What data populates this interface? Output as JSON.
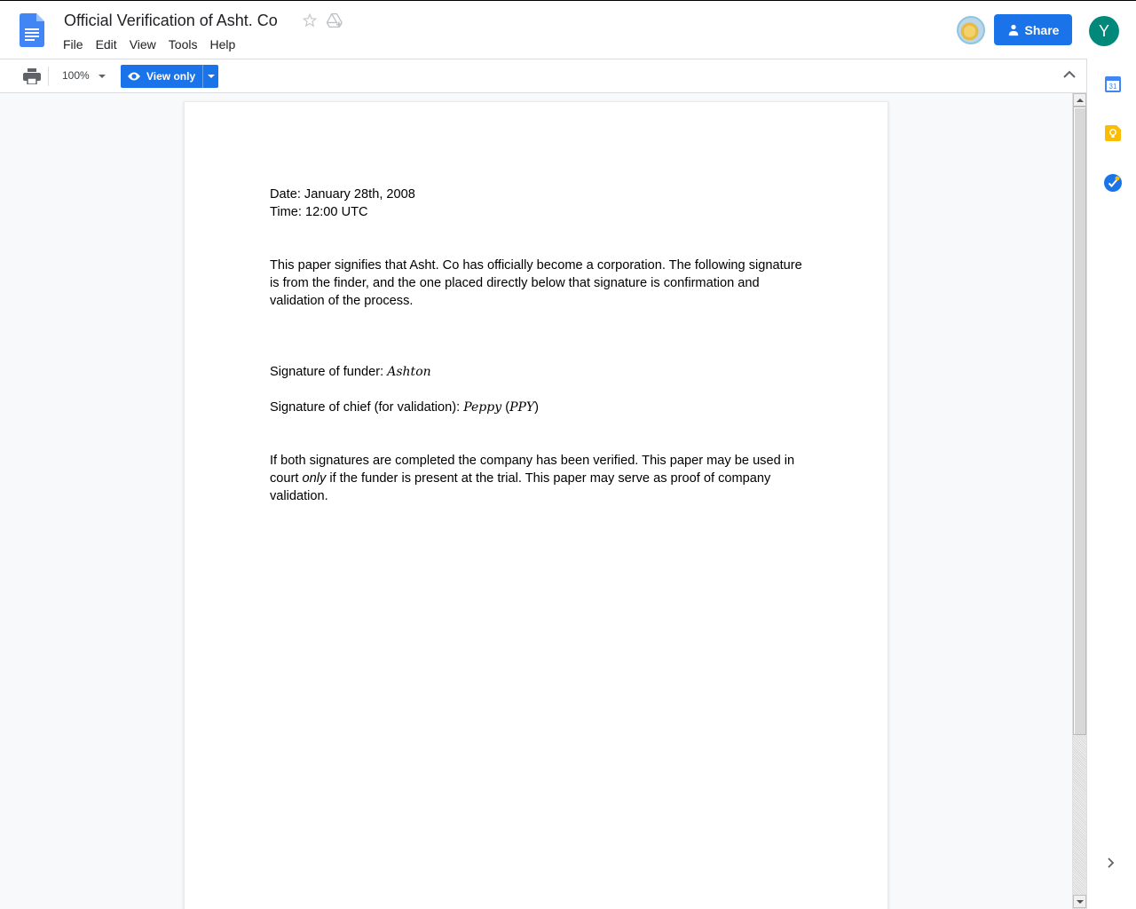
{
  "header": {
    "title": "Official Verification of Asht. Co",
    "menu": [
      "File",
      "Edit",
      "View",
      "Tools",
      "Help"
    ],
    "share_label": "Share",
    "account_initial": "Y"
  },
  "toolbar": {
    "zoom": "100%",
    "mode_label": "View only"
  },
  "document": {
    "date_line": "Date: January 28th, 2008",
    "time_line": "Time: 12:00 UTC",
    "intro": "This paper signifies that Asht. Co has officially become a corporation. The following signature is from the finder, and the one placed directly below that signature is confirmation and validation of the process.",
    "funder_label": "Signature of funder: ",
    "funder_signature": "Ashton",
    "chief_label": "Signature of chief (for validation): ",
    "chief_signature": "Peppy",
    "chief_initials": "(PPY)",
    "closing_part1": "If both signatures are completed the company has been verified. This paper may be used in court ",
    "closing_emphasis": "only",
    "closing_part2": " if the funder is present at the trial. This paper may serve as proof of company validation."
  },
  "colors": {
    "accent": "#1a73e8",
    "account_avatar": "#00897b"
  },
  "icons": [
    "docs-logo-icon",
    "star-icon",
    "drive-icon",
    "share-icon",
    "print-icon",
    "eye-icon",
    "chevron-up-icon",
    "calendar-icon",
    "keep-icon",
    "tasks-icon",
    "chevron-right-icon"
  ]
}
